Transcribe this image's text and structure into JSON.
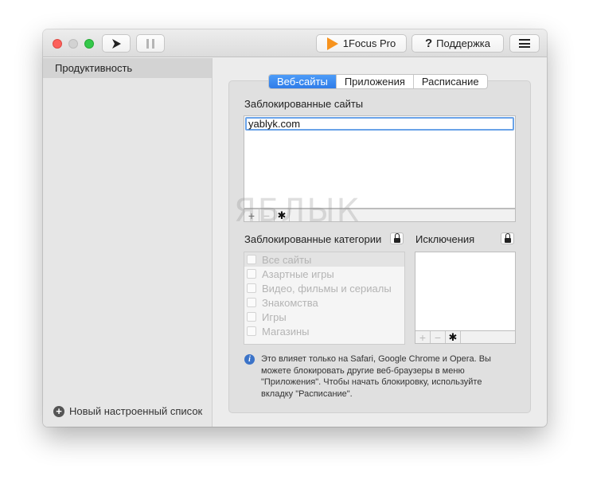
{
  "toolbar": {
    "focus_label": "1Focus Pro",
    "help_label": "Поддержка"
  },
  "sidebar": {
    "items": [
      {
        "label": "Продуктивность",
        "selected": true
      }
    ],
    "footer_label": "Новый настроенный список"
  },
  "tabs": [
    {
      "label": "Веб-сайты",
      "active": true
    },
    {
      "label": "Приложения",
      "active": false
    },
    {
      "label": "Расписание",
      "active": false
    }
  ],
  "blocked_sites": {
    "title": "Заблокированные сайты",
    "items": [
      "yablyk.com"
    ]
  },
  "blocked_categories": {
    "title": "Заблокированные категории",
    "items": [
      "Все сайты",
      "Азартные игры",
      "Видео, фильмы и сериалы",
      "Знакомства",
      "Игры",
      "Магазины"
    ]
  },
  "exceptions": {
    "title": "Исключения"
  },
  "info_text": "Это влияет только на Safari, Google Chrome и Opera. Вы можете блокировать другие веб-браузеры в меню \"Приложения\". Чтобы начать блокировку, используйте вкладку \"Расписание\".",
  "watermark": "ЯБЛЫК",
  "colors": {
    "accent": "#2f7ce8",
    "focus_brand": "#f7931e",
    "traffic_close": "#fc605b",
    "traffic_max": "#34c84a"
  }
}
